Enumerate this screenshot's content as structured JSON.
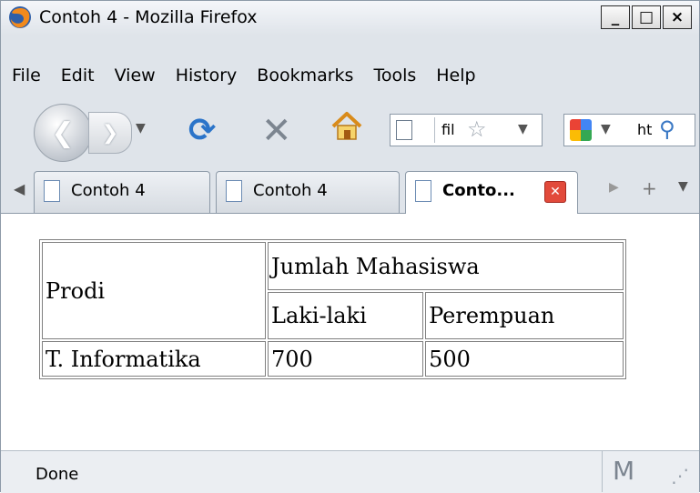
{
  "window": {
    "title": "Contoh 4 - Mozilla Firefox",
    "minimize_label": "_",
    "maximize_label": "□",
    "close_label": "×"
  },
  "menu": [
    "File",
    "Edit",
    "View",
    "History",
    "Bookmarks",
    "Tools",
    "Help"
  ],
  "toolbar": {
    "url_text": "fil",
    "search_text": "ht"
  },
  "tabs": [
    {
      "label": "Contoh 4",
      "active": false
    },
    {
      "label": "Contoh 4",
      "active": false
    },
    {
      "label": "Conto...",
      "active": true
    }
  ],
  "table": {
    "header": {
      "prodi": "Prodi",
      "jumlah": "Jumlah Mahasiswa",
      "laki": "Laki-laki",
      "perempuan": "Perempuan"
    },
    "rows": [
      {
        "prodi": "T. Informatika",
        "laki": "700",
        "perempuan": "500"
      }
    ]
  },
  "status": {
    "text": "Done",
    "addon_icon": "M"
  },
  "icons": {
    "app": "firefox-icon",
    "back": "back-arrow-icon",
    "forward": "forward-arrow-icon",
    "reload": "reload-icon",
    "stop": "stop-icon",
    "home": "home-icon",
    "page": "page-icon",
    "bookmark": "star-icon",
    "search_engine": "google-icon",
    "search": "magnifier-icon",
    "close_tab": "close-tab-icon",
    "new_tab": "plus-icon"
  },
  "colors": {
    "reload_blue": "#2b74c9",
    "close_tab_red": "#e24a3b",
    "chrome_bg": "#dfe4ea"
  }
}
